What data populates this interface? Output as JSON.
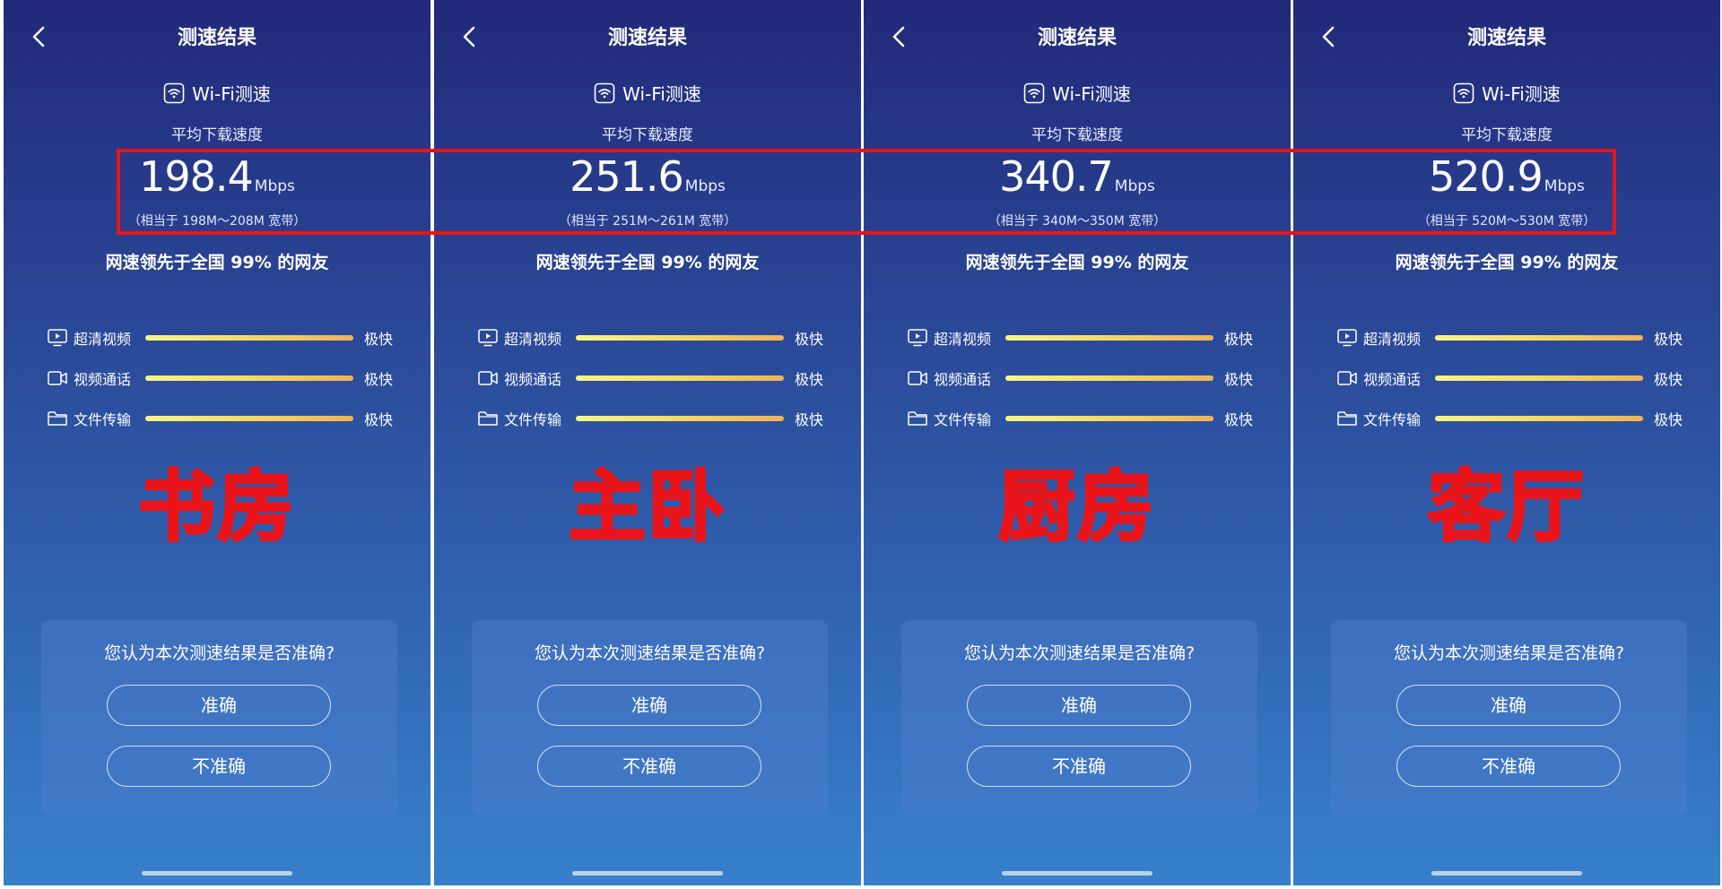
{
  "colors": {
    "gradient_top": "#22297a",
    "gradient_bottom": "#3780cc",
    "annotation_red": "#e8141a",
    "bar_yellow": "#f7f58a",
    "bar_orange": "#f0b258"
  },
  "panels": [
    {
      "title": "测速结果",
      "wifi_label": "Wi-Fi测速",
      "avg_label": "平均下载速度",
      "speed_value": "198.4",
      "speed_unit": "Mbps",
      "equivalent": "（相当于 198M～208M 宽带）",
      "beat_text": "网速领先于全国 99% 的网友",
      "metrics": [
        {
          "icon": "video-play-icon",
          "label": "超清视频",
          "rating": "极快",
          "level": 1.0
        },
        {
          "icon": "video-camera-icon",
          "label": "视频通话",
          "rating": "极快",
          "level": 1.0
        },
        {
          "icon": "folder-icon",
          "label": "文件传输",
          "rating": "极快",
          "level": 1.0
        }
      ],
      "room_label": "书房",
      "feedback": {
        "question": "您认为本次测速结果是否准确?",
        "accurate": "准确",
        "inaccurate": "不准确"
      }
    },
    {
      "title": "测速结果",
      "wifi_label": "Wi-Fi测速",
      "avg_label": "平均下载速度",
      "speed_value": "251.6",
      "speed_unit": "Mbps",
      "equivalent": "（相当于 251M～261M 宽带）",
      "beat_text": "网速领先于全国 99% 的网友",
      "metrics": [
        {
          "icon": "video-play-icon",
          "label": "超清视频",
          "rating": "极快",
          "level": 1.0
        },
        {
          "icon": "video-camera-icon",
          "label": "视频通话",
          "rating": "极快",
          "level": 1.0
        },
        {
          "icon": "folder-icon",
          "label": "文件传输",
          "rating": "极快",
          "level": 1.0
        }
      ],
      "room_label": "主卧",
      "feedback": {
        "question": "您认为本次测速结果是否准确?",
        "accurate": "准确",
        "inaccurate": "不准确"
      }
    },
    {
      "title": "测速结果",
      "wifi_label": "Wi-Fi测速",
      "avg_label": "平均下载速度",
      "speed_value": "340.7",
      "speed_unit": "Mbps",
      "equivalent": "（相当于 340M～350M 宽带）",
      "beat_text": "网速领先于全国 99% 的网友",
      "metrics": [
        {
          "icon": "video-play-icon",
          "label": "超清视频",
          "rating": "极快",
          "level": 1.0
        },
        {
          "icon": "video-camera-icon",
          "label": "视频通话",
          "rating": "极快",
          "level": 1.0
        },
        {
          "icon": "folder-icon",
          "label": "文件传输",
          "rating": "极快",
          "level": 1.0
        }
      ],
      "room_label": "厨房",
      "feedback": {
        "question": "您认为本次测速结果是否准确?",
        "accurate": "准确",
        "inaccurate": "不准确"
      }
    },
    {
      "title": "测速结果",
      "wifi_label": "Wi-Fi测速",
      "avg_label": "平均下载速度",
      "speed_value": "520.9",
      "speed_unit": "Mbps",
      "equivalent": "（相当于 520M～530M 宽带）",
      "beat_text": "网速领先于全国 99% 的网友",
      "metrics": [
        {
          "icon": "video-play-icon",
          "label": "超清视频",
          "rating": "极快",
          "level": 1.0
        },
        {
          "icon": "video-camera-icon",
          "label": "视频通话",
          "rating": "极快",
          "level": 1.0
        },
        {
          "icon": "folder-icon",
          "label": "文件传输",
          "rating": "极快",
          "level": 1.0
        }
      ],
      "room_label": "客厅",
      "feedback": {
        "question": "您认为本次测速结果是否准确?",
        "accurate": "准确",
        "inaccurate": "不准确"
      }
    }
  ]
}
